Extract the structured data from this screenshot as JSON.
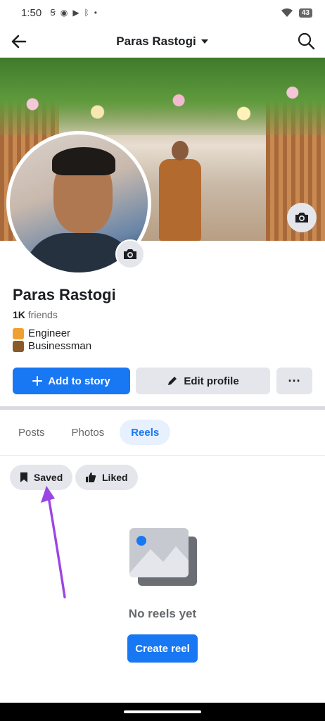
{
  "status_bar": {
    "time": "1:50",
    "notification_icons": [
      "nfc-icon",
      "messenger-icon",
      "youtube-icon",
      "bluetooth-icon",
      "dot-icon"
    ],
    "battery": "43"
  },
  "header": {
    "title": "Paras Rastogi"
  },
  "profile": {
    "name": "Paras Rastogi",
    "friends_count": "1K",
    "friends_label": "friends",
    "bio": [
      {
        "emoji_color": "#f0a030",
        "text": "Engineer"
      },
      {
        "emoji_color": "#8b5a2b",
        "text": "Businessman"
      }
    ]
  },
  "actions": {
    "add_story": "Add to story",
    "edit_profile": "Edit profile",
    "more": "···"
  },
  "tabs": [
    {
      "label": "Posts",
      "active": false
    },
    {
      "label": "Photos",
      "active": false
    },
    {
      "label": "Reels",
      "active": true
    }
  ],
  "filters": {
    "saved": "Saved",
    "liked": "Liked"
  },
  "empty_state": {
    "message": "No reels yet",
    "button": "Create reel"
  },
  "colors": {
    "accent": "#1877f2",
    "arrow": "#9b45e4",
    "tab_active_bg": "#e7f0fd"
  }
}
